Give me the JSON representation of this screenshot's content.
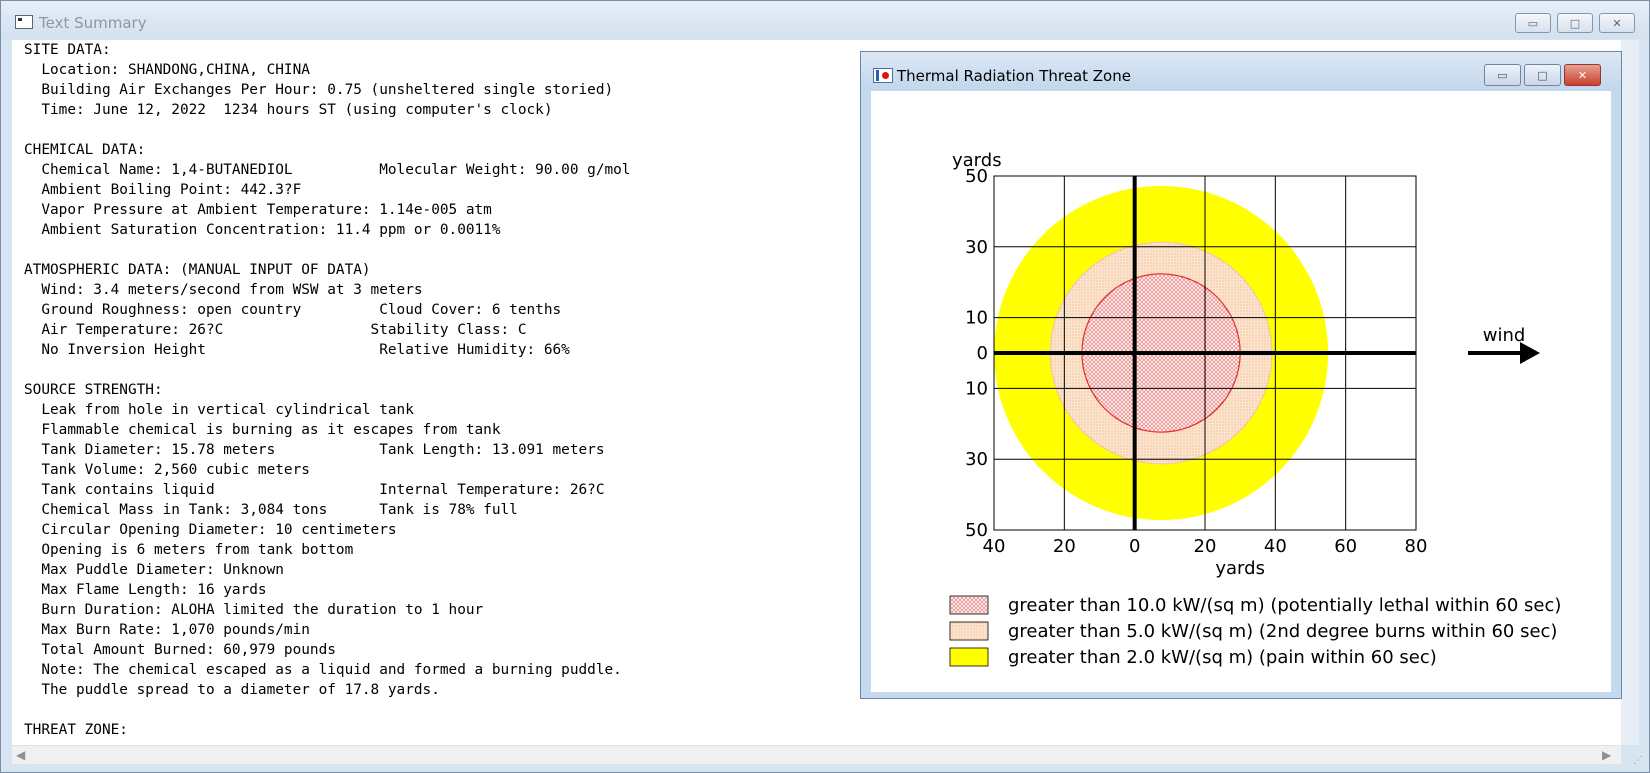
{
  "window": {
    "title": "Text Summary",
    "controls": {
      "minimize": "▭",
      "maximize": "□",
      "close": "✕"
    }
  },
  "summary_lines": [
    "SITE DATA:",
    "  Location: SHANDONG,CHINA, CHINA",
    "  Building Air Exchanges Per Hour: 0.75 (unsheltered single storied)",
    "  Time: June 12, 2022  1234 hours ST (using computer's clock)",
    "",
    "CHEMICAL DATA:",
    "  Chemical Name: 1,4-BUTANEDIOL          Molecular Weight: 90.00 g/mol",
    "  Ambient Boiling Point: 442.3?F",
    "  Vapor Pressure at Ambient Temperature: 1.14e-005 atm",
    "  Ambient Saturation Concentration: 11.4 ppm or 0.0011%",
    "",
    "ATMOSPHERIC DATA: (MANUAL INPUT OF DATA)",
    "  Wind: 3.4 meters/second from WSW at 3 meters",
    "  Ground Roughness: open country         Cloud Cover: 6 tenths",
    "  Air Temperature: 26?C                 Stability Class: C",
    "  No Inversion Height                    Relative Humidity: 66%",
    "",
    "SOURCE STRENGTH:",
    "  Leak from hole in vertical cylindrical tank",
    "  Flammable chemical is burning as it escapes from tank",
    "  Tank Diameter: 15.78 meters            Tank Length: 13.091 meters",
    "  Tank Volume: 2,560 cubic meters",
    "  Tank contains liquid                   Internal Temperature: 26?C",
    "  Chemical Mass in Tank: 3,084 tons      Tank is 78% full",
    "  Circular Opening Diameter: 10 centimeters",
    "  Opening is 6 meters from tank bottom",
    "  Max Puddle Diameter: Unknown",
    "  Max Flame Length: 16 yards",
    "  Burn Duration: ALOHA limited the duration to 1 hour",
    "  Max Burn Rate: 1,070 pounds/min",
    "  Total Amount Burned: 60,979 pounds",
    "  Note: The chemical escaped as a liquid and formed a burning puddle.",
    "  The puddle spread to a diameter of 17.8 yards.",
    "",
    "THREAT ZONE:"
  ],
  "threat_window": {
    "title": "Thermal Radiation Threat Zone",
    "controls": {
      "minimize": "▭",
      "maximize": "□",
      "close": "✕"
    }
  },
  "chart_data": {
    "type": "threat-zone",
    "units": "yards",
    "xlabel": "yards",
    "ylabel": "yards",
    "xlim": [
      -40,
      80
    ],
    "ylim": [
      -50,
      50
    ],
    "x_ticks": [
      -40,
      -20,
      0,
      20,
      40,
      60,
      80
    ],
    "x_tick_labels": [
      "40",
      "20",
      "0",
      "20",
      "40",
      "60",
      "80"
    ],
    "y_ticks": [
      50,
      30,
      10,
      0,
      -10,
      -30,
      -50
    ],
    "y_tick_labels": [
      "50",
      "30",
      "10",
      "0",
      "10",
      "30",
      "50"
    ],
    "grid": true,
    "wind_label": "wind",
    "wind_direction": "right",
    "zones": [
      {
        "label": "greater than 2.0 kW/(sq m) (pain within 60 sec)",
        "center_x": 7.5,
        "center_y": 0,
        "radius": 47.5,
        "color": "#ffff00",
        "stroke": "none",
        "pattern": "solid"
      },
      {
        "label": "greater than 5.0 kW/(sq m) (2nd degree burns within 60 sec)",
        "center_x": 7.5,
        "center_y": 0,
        "radius": 31.5,
        "color": "#f8dcc6",
        "stroke": "#f0c8a0",
        "pattern": "dots-orange"
      },
      {
        "label": "greater than 10.0 kW/(sq m) (potentially lethal within 60 sec)",
        "center_x": 7.5,
        "center_y": 0,
        "radius": 22.5,
        "color": "#fbe2e2",
        "stroke": "#e03030",
        "pattern": "dots-red"
      }
    ],
    "legend": [
      {
        "label": "greater than 10.0 kW/(sq m) (potentially lethal within 60 sec)",
        "pattern": "dots-red"
      },
      {
        "label": "greater than 5.0 kW/(sq m) (2nd degree burns within 60 sec)",
        "pattern": "dots-orange"
      },
      {
        "label": "greater than 2.0 kW/(sq m) (pain within 60 sec)",
        "pattern": "solid-yellow"
      }
    ]
  }
}
